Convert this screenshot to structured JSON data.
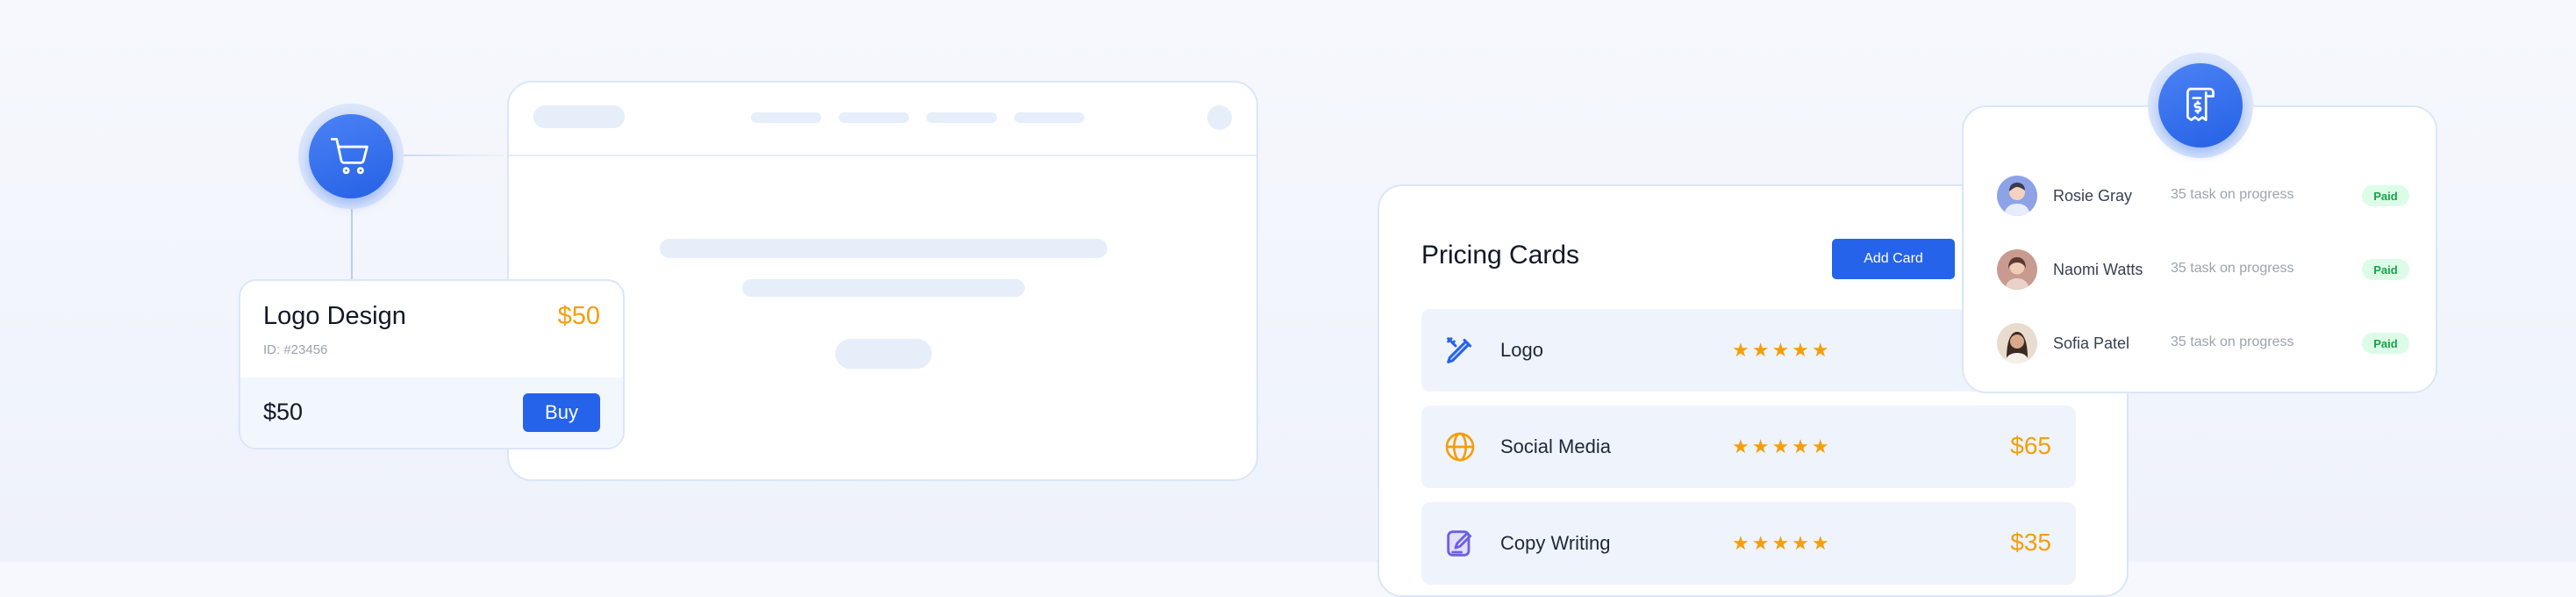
{
  "product_card": {
    "title": "Logo Design",
    "price": "$50",
    "id_text": "ID: #23456",
    "total": "$50",
    "buy_label": "Buy"
  },
  "pricing": {
    "title": "Pricing Cards",
    "add_label": "Add Card",
    "rows": [
      {
        "label": "Logo",
        "rating": 5,
        "stars": "★★★★★",
        "price": "",
        "icon": "pencil-ruler-icon"
      },
      {
        "label": "Social Media",
        "rating": 5,
        "stars": "★★★★★",
        "price": "$65",
        "icon": "globe-icon"
      },
      {
        "label": "Copy Writing",
        "rating": 5,
        "stars": "★★★★★",
        "price": "$35",
        "icon": "edit-document-icon"
      }
    ]
  },
  "team": {
    "members": [
      {
        "name": "Rosie Gray",
        "task": "35 task on progress",
        "status": "Paid"
      },
      {
        "name": "Naomi Watts",
        "task": "35 task on progress",
        "status": "Paid"
      },
      {
        "name": "Sofia Patel",
        "task": "35 task on progress",
        "status": "Paid"
      }
    ]
  },
  "icons": {
    "cart": "shopping-cart-icon",
    "invoice": "invoice-dollar-icon"
  },
  "colors": {
    "accent": "#2563eb",
    "price": "#f59e0b",
    "paid_bg": "#dcfce7",
    "paid_text": "#16a34a"
  }
}
